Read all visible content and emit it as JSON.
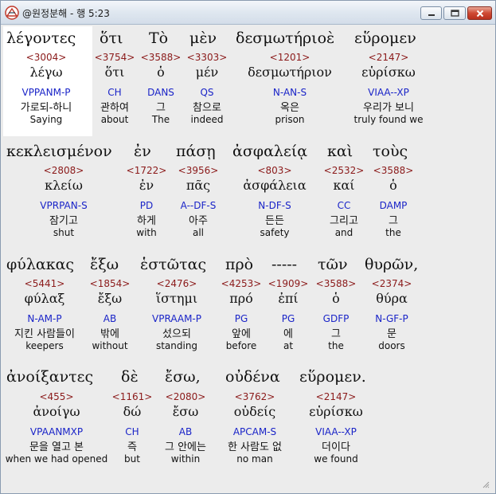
{
  "window": {
    "title": "@원정분해 - 행 5:23"
  },
  "rows": [
    {
      "greek": [
        "λέγοντες",
        "ὅτι",
        "Τὸ",
        "μὲν",
        "δεσμωτήριοὲ",
        "εὕρομεν"
      ],
      "words": [
        {
          "num": "<3004>",
          "lemma": "λέγω",
          "morph": "VPPANM-P",
          "kor": "가로되-하니",
          "eng": "Saying"
        },
        {
          "num": "<3754>",
          "lemma": "ὅτι",
          "morph": "CH",
          "kor": "관하여",
          "eng": "about"
        },
        {
          "num": "<3588>",
          "lemma": "ὁ",
          "morph": "DANS",
          "kor": "그",
          "eng": "The"
        },
        {
          "num": "<3303>",
          "lemma": "μέν",
          "morph": "QS",
          "kor": "참으로",
          "eng": "indeed"
        },
        {
          "num": "<1201>",
          "lemma": "δεσμωτήριον",
          "morph": "N-AN-S",
          "kor": "옥은",
          "eng": "prison"
        },
        {
          "num": "<2147>",
          "lemma": "εὑρίσκω",
          "morph": "VIAA--XP",
          "kor": "우리가 보니",
          "eng": "truly found we"
        }
      ]
    },
    {
      "greek": [
        "κεκλεισμένον",
        "ἐν",
        "πάσῃ",
        "ἀσφαλείᾳ",
        "καὶ",
        "τοὺς"
      ],
      "words": [
        {
          "num": "<2808>",
          "lemma": "κλείω",
          "morph": "VPRPAN-S",
          "kor": "잠기고",
          "eng": "shut"
        },
        {
          "num": "<1722>",
          "lemma": "ἐν",
          "morph": "PD",
          "kor": "하게",
          "eng": "with"
        },
        {
          "num": "<3956>",
          "lemma": "πᾶς",
          "morph": "A--DF-S",
          "kor": "아주",
          "eng": "all"
        },
        {
          "num": "<803>",
          "lemma": "ἀσφάλεια",
          "morph": "N-DF-S",
          "kor": "든든",
          "eng": "safety"
        },
        {
          "num": "<2532>",
          "lemma": "καί",
          "morph": "CC",
          "kor": "그리고",
          "eng": "and"
        },
        {
          "num": "<3588>",
          "lemma": "ὁ",
          "morph": "DAMP",
          "kor": "그",
          "eng": "the"
        }
      ]
    },
    {
      "greek": [
        "φύλακας",
        "ἔξω",
        "ἑστῶτας",
        "πρὸ",
        "-----",
        "τῶν",
        "θυρῶν,"
      ],
      "words": [
        {
          "num": "<5441>",
          "lemma": "φύλαξ",
          "morph": "N-AM-P",
          "kor": "지킨 사람들이",
          "eng": "keepers"
        },
        {
          "num": "<1854>",
          "lemma": "ἔξω",
          "morph": "AB",
          "kor": "밖에",
          "eng": "without"
        },
        {
          "num": "<2476>",
          "lemma": "ἵστημι",
          "morph": "VPRAAM-P",
          "kor": "섰으되",
          "eng": "standing"
        },
        {
          "num": "<4253>",
          "lemma": "πρό",
          "morph": "PG",
          "kor": "앞에",
          "eng": "before"
        },
        {
          "num": "<1909>",
          "lemma": "ἐπί",
          "morph": "PG",
          "kor": "에",
          "eng": "at"
        },
        {
          "num": "<3588>",
          "lemma": "ὁ",
          "morph": "GDFP",
          "kor": "그",
          "eng": "the"
        },
        {
          "num": "<2374>",
          "lemma": "θύρα",
          "morph": "N-GF-P",
          "kor": "문",
          "eng": "doors"
        }
      ]
    },
    {
      "greek": [
        "ἀνοίξαντες",
        "δὲ",
        "ἔσω,",
        "οὐδένα",
        "εὕρομεν."
      ],
      "words": [
        {
          "num": "<455>",
          "lemma": "ἀνοίγω",
          "morph": "VPAANMXP",
          "kor": "문을 열고 본",
          "eng": "when we had opened"
        },
        {
          "num": "<1161>",
          "lemma": "δώ",
          "morph": "CH",
          "kor": "즉",
          "eng": "but"
        },
        {
          "num": "<2080>",
          "lemma": "ἔσω",
          "morph": "AB",
          "kor": "그 안에는",
          "eng": "within"
        },
        {
          "num": "<3762>",
          "lemma": "οὐδείς",
          "morph": "APCAM-S",
          "kor": "한 사람도 없",
          "eng": "no man"
        },
        {
          "num": "<2147>",
          "lemma": "εὑρίσκω",
          "morph": "VIAA--XP",
          "kor": "더이다",
          "eng": "we found"
        }
      ]
    }
  ]
}
